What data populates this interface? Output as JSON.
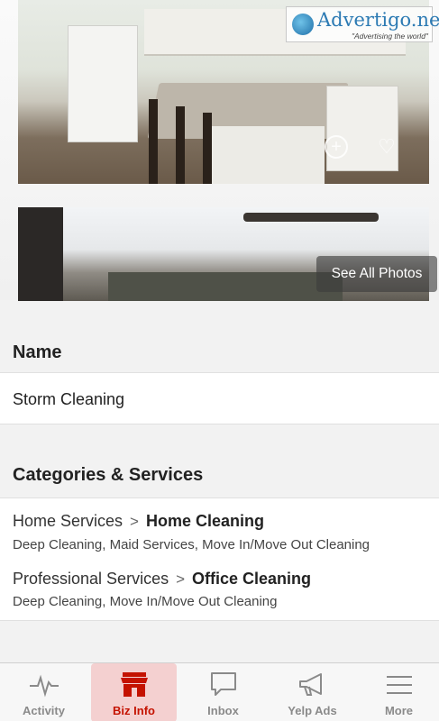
{
  "photos": {
    "see_all_label": "See All Photos"
  },
  "watermark": {
    "brand": "Advertigo.net",
    "tagline": "\"Advertising the world\""
  },
  "sections": {
    "name": {
      "heading": "Name",
      "value": "Storm Cleaning"
    },
    "categories": {
      "heading": "Categories & Services",
      "items": [
        {
          "parent": "Home Services",
          "child": "Home Cleaning",
          "services": "Deep Cleaning, Maid Services, Move In/Move Out Cleaning"
        },
        {
          "parent": "Professional Services",
          "child": "Office Cleaning",
          "services": "Deep Cleaning, Move In/Move Out Cleaning"
        }
      ]
    }
  },
  "tabbar": {
    "active_color": "#c41200",
    "tabs": [
      {
        "label": "Activity",
        "icon": "activity-pulse-icon"
      },
      {
        "label": "Biz Info",
        "icon": "storefront-icon",
        "active": true
      },
      {
        "label": "Inbox",
        "icon": "speech-bubble-icon"
      },
      {
        "label": "Yelp Ads",
        "icon": "megaphone-icon"
      },
      {
        "label": "More",
        "icon": "hamburger-menu-icon"
      }
    ]
  }
}
